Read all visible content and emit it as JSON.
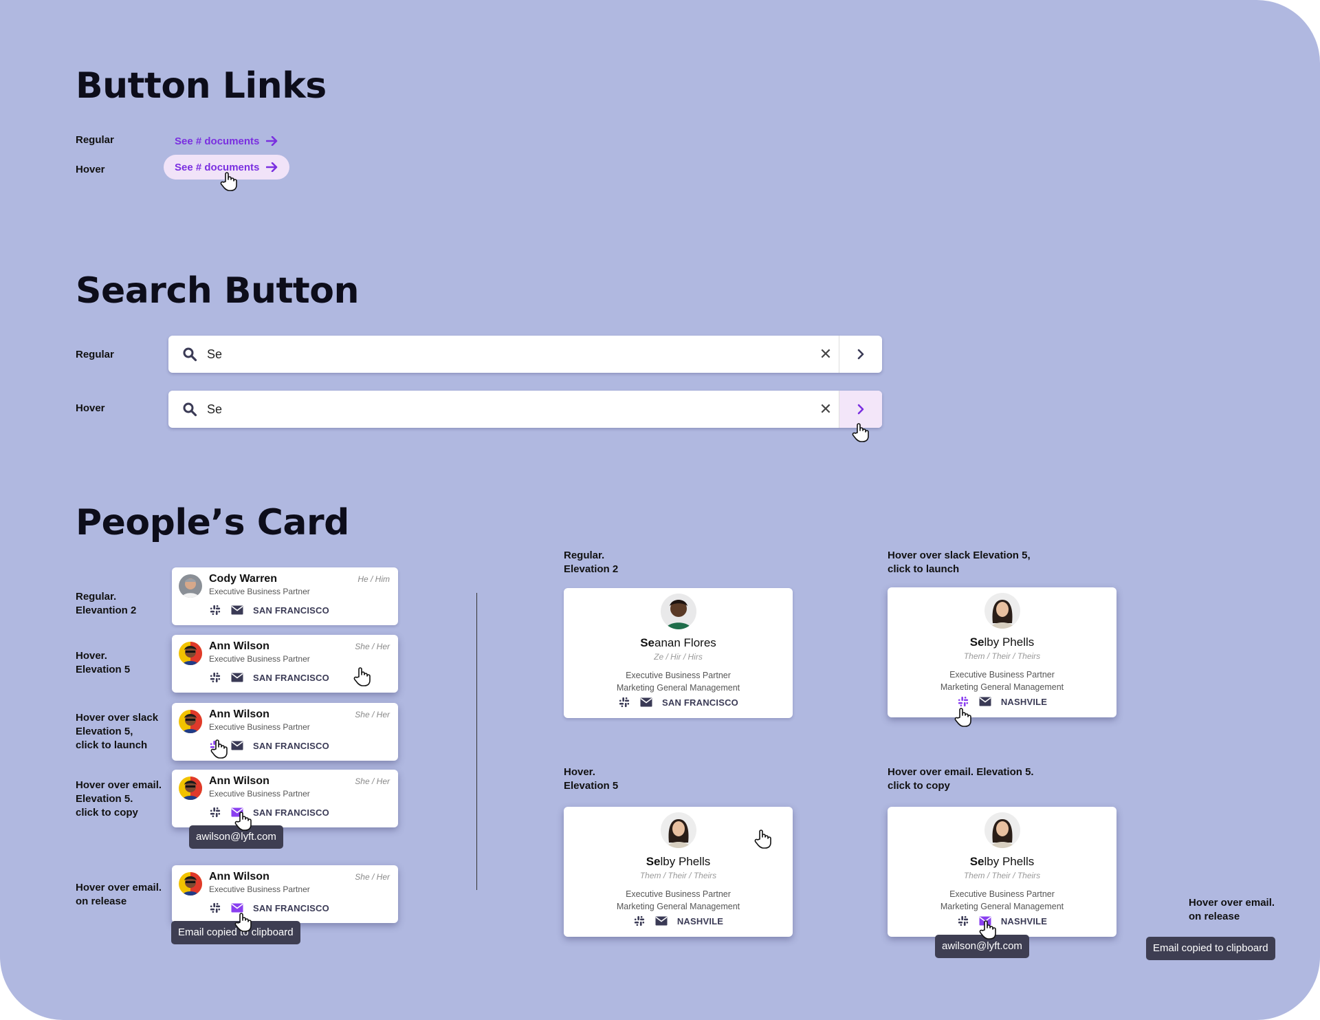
{
  "sections": {
    "button_links": {
      "title": "Button Links",
      "regular_label": "Regular",
      "hover_label": "Hover",
      "link_text": "See # documents"
    },
    "search_button": {
      "title": "Search Button",
      "regular_label": "Regular",
      "hover_label": "Hover",
      "query": "Se"
    },
    "peoples_card": {
      "title": "People’s Card",
      "small_cards": [
        {
          "label": "Regular.\nElevantion 2",
          "name": "Cody Warren",
          "pronouns": "He / Him",
          "role": "Executive Business Partner",
          "location": "SAN FRANCISCO",
          "state": "regular"
        },
        {
          "label": "Hover.\nElevation 5",
          "name": "Ann Wilson",
          "pronouns": "She / Her",
          "role": "Executive Business Partner",
          "location": "SAN FRANCISCO",
          "state": "hover"
        },
        {
          "label": "Hover over slack\nElevation 5,\nclick to launch",
          "name": "Ann Wilson",
          "pronouns": "She / Her",
          "role": "Executive Business Partner",
          "location": "SAN FRANCISCO",
          "state": "slack"
        },
        {
          "label": "Hover over email.\nElevation 5.\nclick to copy",
          "name": "Ann Wilson",
          "pronouns": "She / Her",
          "role": "Executive Business Partner",
          "location": "SAN FRANCISCO",
          "state": "email",
          "tooltip": "awilson@lyft.com"
        },
        {
          "label": "Hover over email.\non release",
          "name": "Ann Wilson",
          "pronouns": "She / Her",
          "role": "Executive Business Partner",
          "location": "SAN FRANCISCO",
          "state": "email-release",
          "tooltip": "Email copied to clipboard"
        }
      ],
      "large_cards": [
        {
          "label": "Regular.\nElevation 2",
          "name_bold": "Se",
          "name_rest": "anan Flores",
          "pronouns": "Ze / Hir / Hirs",
          "role1": "Executive Business Partner",
          "role2": "Marketing General Management",
          "location": "SAN FRANCISCO"
        },
        {
          "label": "Hover over slack Elevation 5,\nclick to launch",
          "name_bold": "Se",
          "name_rest": "lby Phells",
          "pronouns": "Them / Their / Theirs",
          "role1": "Executive Business Partner",
          "role2": "Marketing General Management",
          "location": "NASHVILE"
        },
        {
          "label": "Hover.\nElevation 5",
          "name_bold": "Se",
          "name_rest": "lby Phells",
          "pronouns": "Them / Their / Theirs",
          "role1": "Executive Business Partner",
          "role2": "Marketing General Management",
          "location": "NASHVILE"
        },
        {
          "label": "Hover over email. Elevation 5.\nclick to copy",
          "name_bold": "Se",
          "name_rest": "lby Phells",
          "pronouns": "Them / Their / Theirs",
          "role1": "Executive Business Partner",
          "role2": "Marketing General Management",
          "location": "NASHVILE",
          "tooltip": "awilson@lyft.com"
        }
      ],
      "release_note": {
        "label": "Hover over email.\non release",
        "tooltip": "Email copied to clipboard"
      }
    }
  },
  "colors": {
    "background": "#b0b8e0",
    "accent": "#7a2fe0",
    "hover_bg": "#f1e3f8",
    "tooltip": "#3e3e52"
  }
}
